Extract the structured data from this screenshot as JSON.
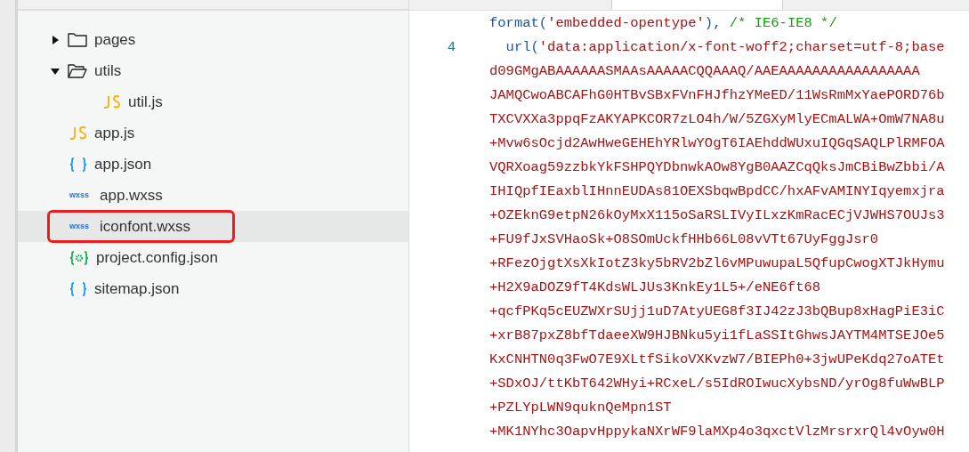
{
  "file_tree": [
    {
      "kind": "folder",
      "name": "pages",
      "expanded": false,
      "selected": false,
      "marked": false
    },
    {
      "kind": "folder",
      "name": "utils",
      "expanded": true,
      "selected": false,
      "marked": false,
      "children": [
        {
          "kind": "js",
          "name": "util.js",
          "selected": false,
          "marked": false
        }
      ]
    },
    {
      "kind": "js",
      "name": "app.js",
      "selected": false,
      "marked": false
    },
    {
      "kind": "json",
      "name": "app.json",
      "selected": false,
      "marked": false
    },
    {
      "kind": "wxss",
      "name": "app.wxss",
      "icon_text": "wxss",
      "selected": false,
      "marked": false
    },
    {
      "kind": "wxss",
      "name": "iconfont.wxss",
      "icon_text": "wxss",
      "selected": true,
      "marked": true
    },
    {
      "kind": "config",
      "name": "project.config.json",
      "selected": false,
      "marked": false
    },
    {
      "kind": "json",
      "name": "sitemap.json",
      "selected": false,
      "marked": false
    }
  ],
  "editor": {
    "lines": [
      {
        "segments": [
          {
            "kind": "function",
            "text": "format("
          },
          {
            "kind": "string",
            "text": "'embedded-opentype'"
          },
          {
            "kind": "function",
            "text": "), "
          },
          {
            "kind": "comment",
            "text": "/* IE6-IE8 */"
          }
        ]
      },
      {
        "number": "4",
        "segments": [
          {
            "kind": "function",
            "text": "  url("
          },
          {
            "kind": "string",
            "text": "'data:application/x-font-woff2;charset=utf-8;base"
          }
        ]
      },
      {
        "segments": [
          {
            "kind": "string",
            "text": "d09GMgABAAAAAASMAAsAAAAACQQAAAQ/AAEAAAAAAAAAAAAAAAAA"
          }
        ]
      },
      {
        "segments": [
          {
            "kind": "string",
            "text": "JAMQCwoABCAFhG0HTBvSBxFVnFHJfhzYMeED/11WsRmMxYaePORD76b"
          }
        ]
      },
      {
        "segments": [
          {
            "kind": "string",
            "text": "TXCVXXa3ppqFzAKYAPKCOR7zLO4h/W/5ZGXyMlyECmALWA+OmW7NA8u"
          }
        ]
      },
      {
        "segments": [
          {
            "kind": "string",
            "text": "+Mvw6sOcjd2AwHweGEHEhYRlwYOgT6IAEhddWUxuIQGqSAQLPlRMFOA"
          }
        ]
      },
      {
        "segments": [
          {
            "kind": "string",
            "text": "VQRXoag59zzbkYkFSHPQYDbnwkAOw8YgB0AAZCqQksJmCBiBwZbbi/A"
          }
        ]
      },
      {
        "segments": [
          {
            "kind": "string",
            "text": "IHIQpfIEaxblIHnnEUDAs81OEXSbqwBpdCC/hxAFvAMINYIqyemxjra"
          }
        ]
      },
      {
        "segments": [
          {
            "kind": "string",
            "text": "+OZEknG9etpN26kOyMxX115oSaRSLIVyILxzKmRacECjVJWHS7OUJs3"
          }
        ]
      },
      {
        "segments": [
          {
            "kind": "string",
            "text": "+FU9fJxSVHaoSk+O8SOmUckfHHb66L08vVTt67UyFggJsr0"
          }
        ]
      },
      {
        "segments": [
          {
            "kind": "string",
            "text": "+RFezOjgtXsXkIotZ3ky5bRV2bZl6vMPuwupaL5QfupCwogXTJkHymu"
          }
        ]
      },
      {
        "segments": [
          {
            "kind": "string",
            "text": "+H2X9aDOZ9fT4KdsWLJUs3KnkEy1L5+/eNE6ft68"
          }
        ]
      },
      {
        "segments": [
          {
            "kind": "string",
            "text": "+qcfPKq5cEUZWXrSUjj1uD7AtyUEG8f3IJ42zJ3bQBup8xHagPiE3iC"
          }
        ]
      },
      {
        "segments": [
          {
            "kind": "string",
            "text": "+xrB87pxZ8bfTdaeeXW9HJBNku5yi1fLaSSItGhwsJAYTM4MTSEJOe5"
          }
        ]
      },
      {
        "segments": [
          {
            "kind": "string",
            "text": "KxCNHTN0q3FwO7E9XLtfSikoVXKvzW7/BIEPh0+3jwUPeKdq27oATEt"
          }
        ]
      },
      {
        "segments": [
          {
            "kind": "string",
            "text": "+SDxOJ/ttKbT642WHyi+RCxeL/s5IdROIwucXybsND/yrOg8fuWwBLP"
          }
        ]
      },
      {
        "segments": [
          {
            "kind": "string",
            "text": "+PZLYpLWN9quknQeMpn1ST"
          }
        ]
      },
      {
        "segments": [
          {
            "kind": "string",
            "text": "+MK1NYhc3OapvHppykaNXrWF9laMXp4o3qxctVlzMrsrxrQl4vOyw0H"
          }
        ]
      }
    ]
  }
}
